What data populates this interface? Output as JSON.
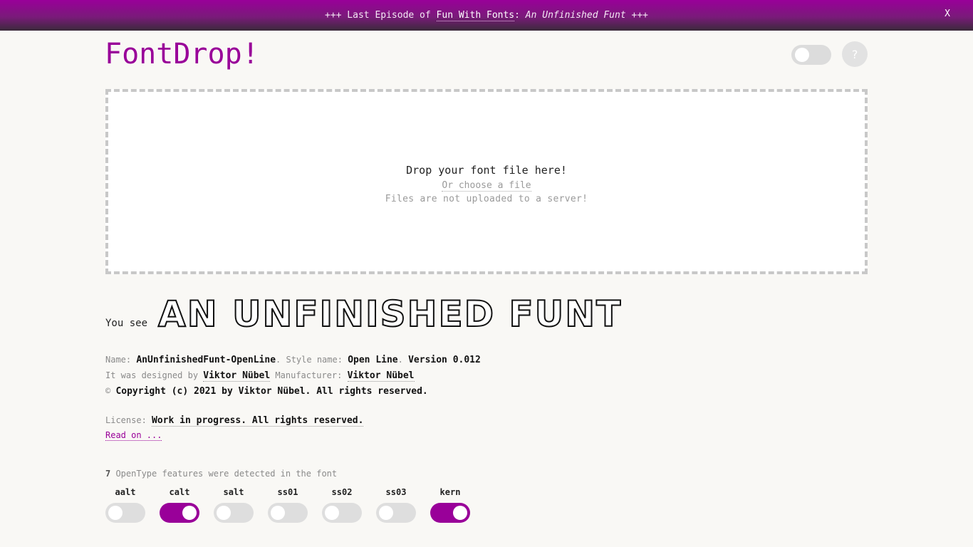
{
  "banner": {
    "prefix": "+++ Last Episode of ",
    "link": "Fun With Fonts",
    "colon": ": ",
    "italic": "An Unfinished Funt",
    "suffix": " +++",
    "close": "X"
  },
  "header": {
    "logo": "FontDrop!",
    "help": "?"
  },
  "dropzone": {
    "title": "Drop your font file here!",
    "choose": "Or choose a file",
    "note": "Files are not uploaded to a server!"
  },
  "preview": {
    "label": "You see",
    "sample": "AN UNFINISHED FUNT"
  },
  "meta": {
    "name_label": "Name: ",
    "name": "AnUnfinishedFunt-OpenLine",
    "style_label": ". Style name: ",
    "style": "Open Line",
    "version_sep": ". ",
    "version": "Version 0.012",
    "designed_label": "It was designed by ",
    "designer": "Viktor Nübel",
    "manufacturer_label": " Manufacturer: ",
    "manufacturer": "Viktor Nübel",
    "copyright_symbol": "© ",
    "copyright": "Copyright (c) 2021 by Viktor Nübel. All rights reserved.",
    "license_label": "License: ",
    "license": "Work in progress. All rights reserved.",
    "read_on": "Read on ..."
  },
  "features": {
    "count": "7",
    "count_text": " OpenType features were detected in the font",
    "items": [
      {
        "label": "aalt",
        "on": false
      },
      {
        "label": "calt",
        "on": true
      },
      {
        "label": "salt",
        "on": false
      },
      {
        "label": "ss01",
        "on": false
      },
      {
        "label": "ss02",
        "on": false
      },
      {
        "label": "ss03",
        "on": false
      },
      {
        "label": "kern",
        "on": true
      }
    ]
  },
  "colors": {
    "accent": "#990099"
  }
}
